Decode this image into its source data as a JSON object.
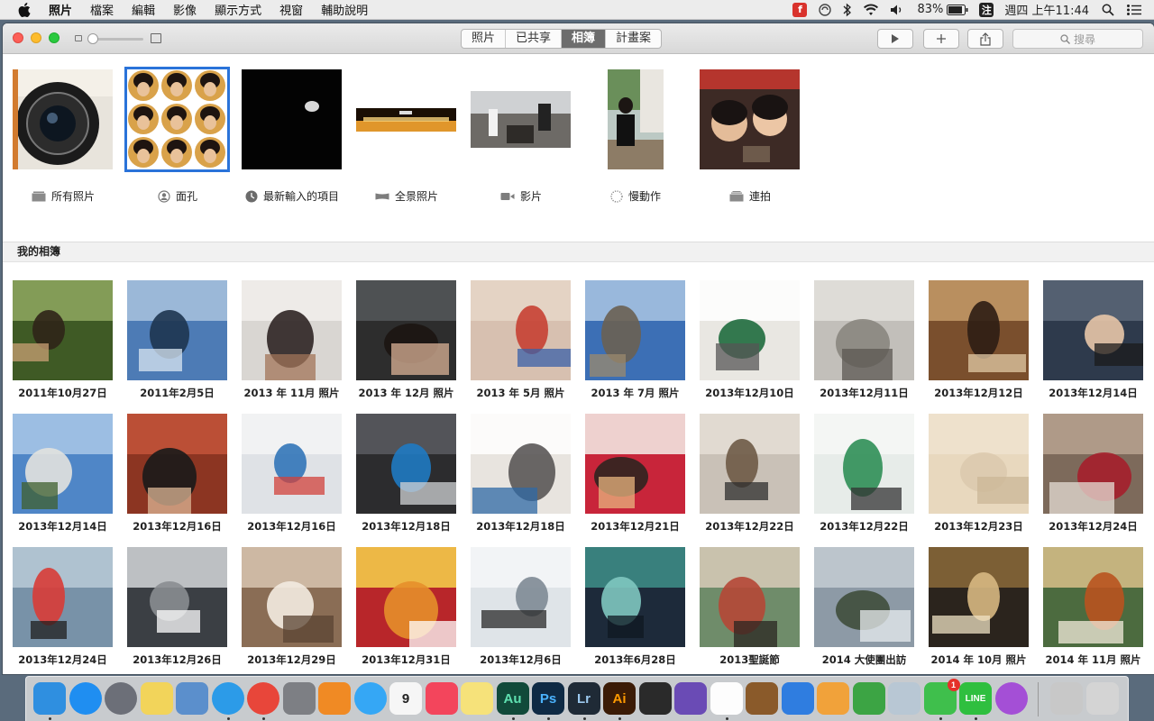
{
  "menubar": {
    "app_menu": "照片",
    "items": [
      "檔案",
      "編輯",
      "影像",
      "顯示方式",
      "視窗",
      "輔助說明"
    ],
    "battery": "83%",
    "input_method": "注",
    "clock": "週四 上午11:44"
  },
  "toolbar": {
    "tabs": [
      {
        "label": "照片",
        "active": false
      },
      {
        "label": "已共享",
        "active": false
      },
      {
        "label": "相簿",
        "active": true
      },
      {
        "label": "計畫案",
        "active": false
      }
    ],
    "search_placeholder": "搜尋"
  },
  "smart_albums": [
    {
      "label": "所有照片",
      "icon": "photos-stack-icon"
    },
    {
      "label": "面孔",
      "icon": "face-icon",
      "selected": true
    },
    {
      "label": "最新輸入的項目",
      "icon": "clock-icon"
    },
    {
      "label": "全景照片",
      "icon": "panorama-icon"
    },
    {
      "label": "影片",
      "icon": "video-camera-icon"
    },
    {
      "label": "慢動作",
      "icon": "slow-motion-icon"
    },
    {
      "label": "連拍",
      "icon": "burst-icon"
    }
  ],
  "section_title": "我的相簿",
  "albums": [
    {
      "title": "2011年10月27日"
    },
    {
      "title": "2011年2月5日"
    },
    {
      "title": "2013 年 11月 照片"
    },
    {
      "title": "2013 年 12月 照片"
    },
    {
      "title": "2013 年 5月 照片"
    },
    {
      "title": "2013 年 7月 照片"
    },
    {
      "title": "2013年12月10日"
    },
    {
      "title": "2013年12月11日"
    },
    {
      "title": "2013年12月12日"
    },
    {
      "title": "2013年12月14日"
    },
    {
      "title": "2013年12月14日"
    },
    {
      "title": "2013年12月16日"
    },
    {
      "title": "2013年12月16日"
    },
    {
      "title": "2013年12月18日"
    },
    {
      "title": "2013年12月18日"
    },
    {
      "title": "2013年12月21日"
    },
    {
      "title": "2013年12月22日"
    },
    {
      "title": "2013年12月22日"
    },
    {
      "title": "2013年12月23日"
    },
    {
      "title": "2013年12月24日"
    },
    {
      "title": "2013年12月24日"
    },
    {
      "title": "2013年12月26日"
    },
    {
      "title": "2013年12月29日"
    },
    {
      "title": "2013年12月31日"
    },
    {
      "title": "2013年12月6日"
    },
    {
      "title": "2013年6月28日"
    },
    {
      "title": "2013聖誕節"
    },
    {
      "title": "2014 大使團出訪"
    },
    {
      "title": "2014 年 10月 照片"
    },
    {
      "title": "2014 年 11月 照片"
    }
  ],
  "dock": {
    "apps": [
      {
        "name": "finder-icon"
      },
      {
        "name": "app-store-icon"
      },
      {
        "name": "launchpad-icon"
      },
      {
        "name": "stickies-icon"
      },
      {
        "name": "preview-icon"
      },
      {
        "name": "safari-icon"
      },
      {
        "name": "chrome-icon"
      },
      {
        "name": "system-preferences-icon"
      },
      {
        "name": "ibooks-icon"
      },
      {
        "name": "messages-icon"
      },
      {
        "name": "calendar-icon",
        "label": "9"
      },
      {
        "name": "itunes-icon"
      },
      {
        "name": "notes-icon"
      },
      {
        "name": "audition-icon",
        "label": "Au"
      },
      {
        "name": "photoshop-icon",
        "label": "Ps"
      },
      {
        "name": "lightroom-icon",
        "label": "Lr"
      },
      {
        "name": "illustrator-icon",
        "label": "Ai"
      },
      {
        "name": "final-cut-icon"
      },
      {
        "name": "motion-icon"
      },
      {
        "name": "photos-icon"
      },
      {
        "name": "garageband-icon"
      },
      {
        "name": "keynote-icon"
      },
      {
        "name": "pages-icon"
      },
      {
        "name": "numbers-icon"
      },
      {
        "name": "preview-photos-icon"
      },
      {
        "name": "facetime-icon",
        "badge": "1"
      },
      {
        "name": "line-icon",
        "label": "LINE"
      },
      {
        "name": "question-icon"
      },
      {
        "name": "downloads-icon"
      },
      {
        "name": "trash-icon"
      }
    ]
  }
}
